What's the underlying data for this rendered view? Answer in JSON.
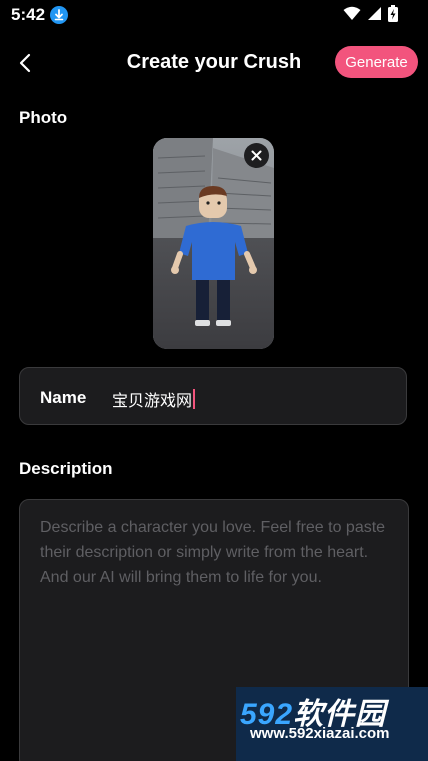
{
  "status_bar": {
    "time": "5:42"
  },
  "header": {
    "title": "Create your Crush",
    "generate_label": "Generate"
  },
  "photo_section": {
    "label": "Photo"
  },
  "name_field": {
    "label": "Name",
    "value": "宝贝游戏网"
  },
  "description_section": {
    "label": "Description",
    "placeholder": "Describe a character you love. Feel free to paste their description or simply write from the heart. And our AI will bring them to life for you."
  },
  "watermark": {
    "digits": "592",
    "chinese": "软件园",
    "url": "www.592xiazai.com"
  },
  "colors": {
    "accent": "#f2547d",
    "field_bg": "#1c1c1e",
    "download_badge": "#2196f3"
  }
}
